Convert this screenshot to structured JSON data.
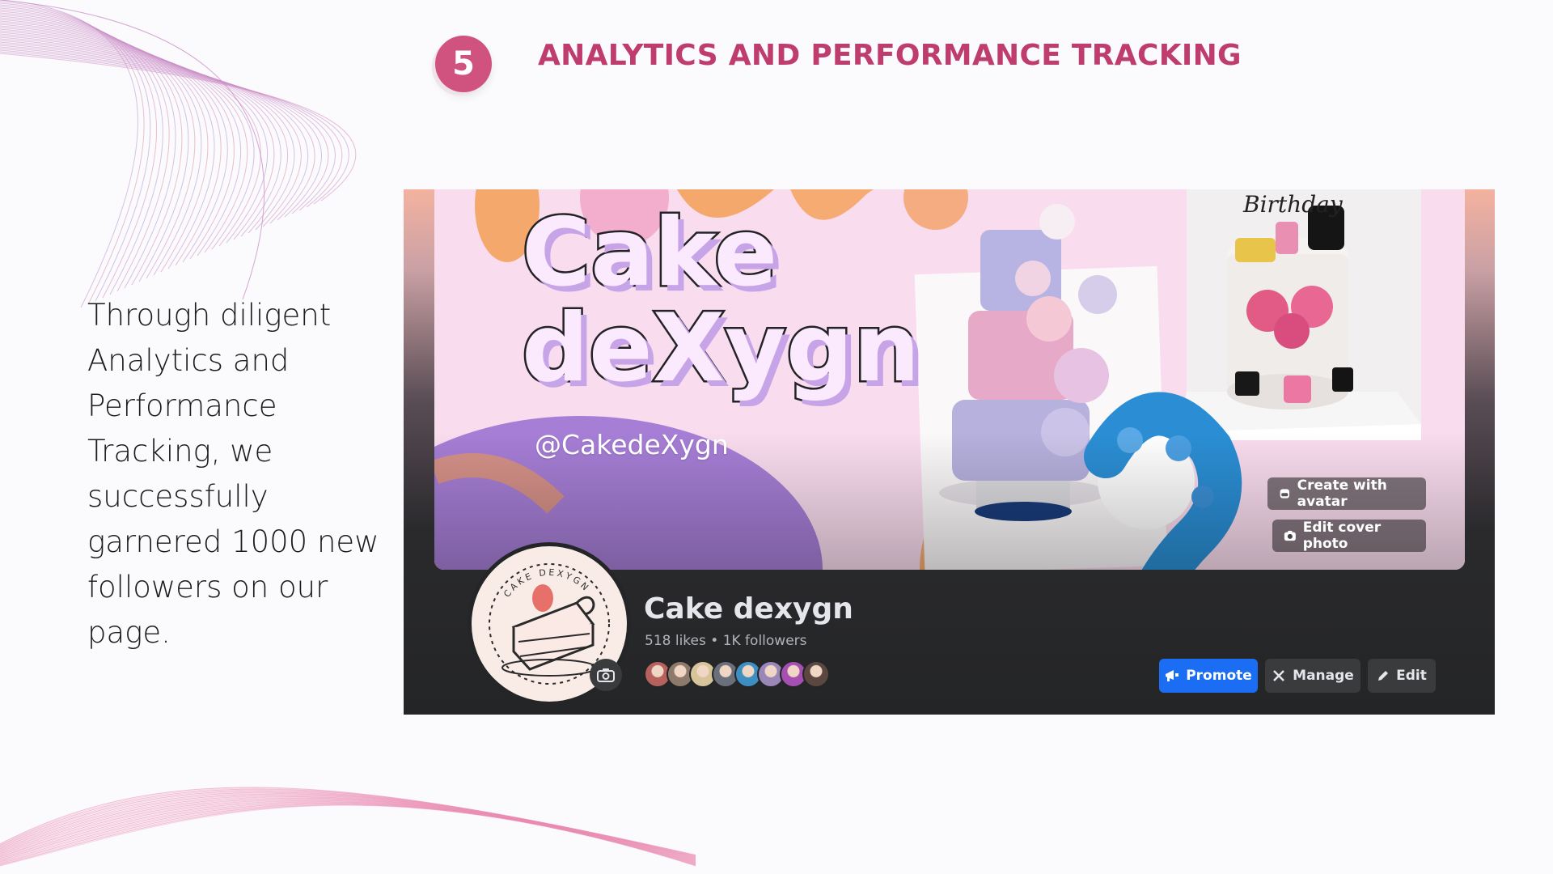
{
  "step": {
    "number": "5"
  },
  "title": "ANALYTICS AND PERFORMANCE TRACKING",
  "description": "Through diligent Analytics and Performance Tracking, we successfully garnered 1000 new followers on our page.",
  "facebook": {
    "cover": {
      "brand_name_line1": "Cake",
      "brand_name_line2": "deXygn",
      "handle": "@CakedeXygn",
      "cake_topper_text": "Birthday",
      "create_avatar_label": "Create with avatar",
      "edit_cover_label": "Edit cover photo"
    },
    "profile": {
      "logo_text": "CAKE DEXYGN",
      "name": "Cake dexygn",
      "stats": "518 likes • 1K followers"
    },
    "actions": {
      "promote_label": "Promote",
      "manage_label": "Manage",
      "edit_label": "Edit"
    },
    "friend_avatar_colors": [
      "#b7615e",
      "#8e7a6a",
      "#d8c49a",
      "#6a6f7a",
      "#3c8fc0",
      "#9b86b8",
      "#a64fb2",
      "#5c4640"
    ]
  },
  "colors": {
    "accent_pink": "#bf3d6e",
    "badge_pink": "#d0527f",
    "fb_blue": "#1b6ef3",
    "fb_dark": "#242526"
  }
}
